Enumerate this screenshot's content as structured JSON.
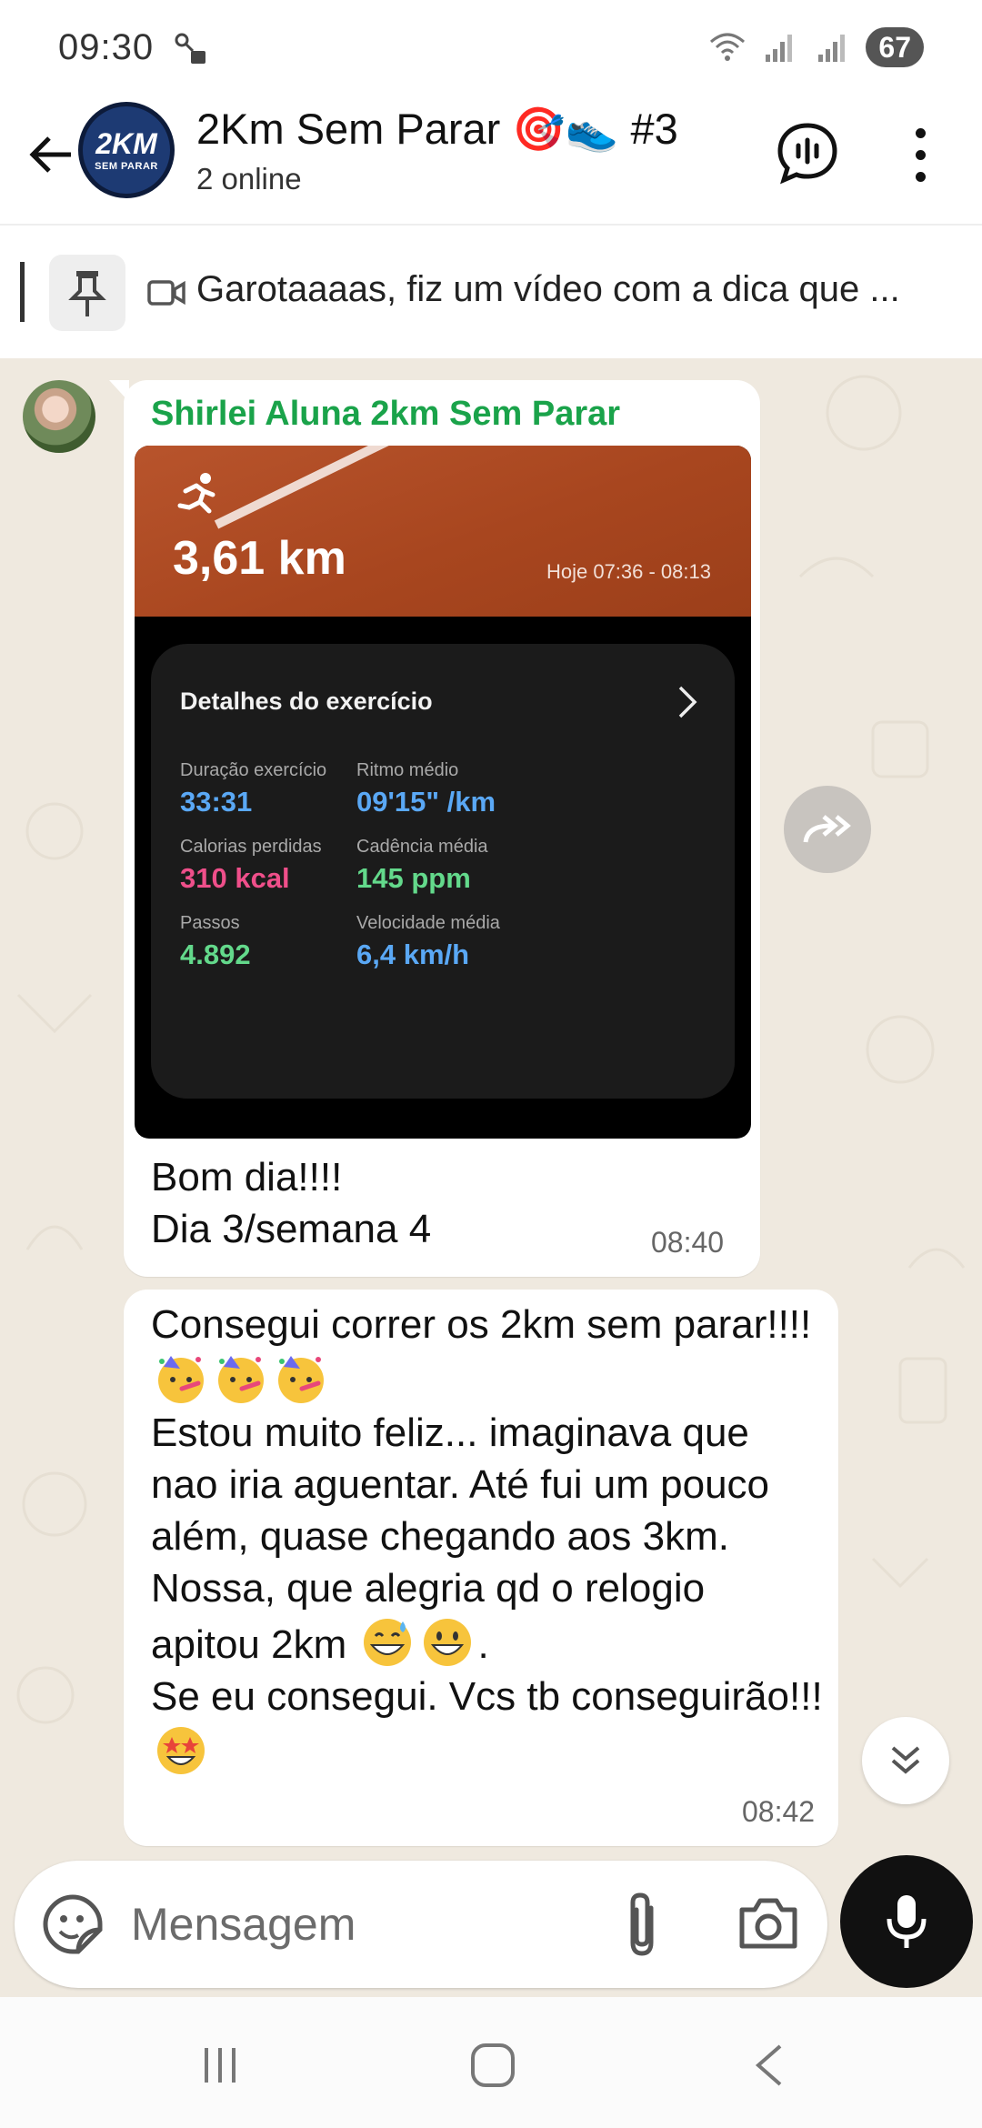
{
  "status_bar": {
    "time": "09:30",
    "battery": "67"
  },
  "header": {
    "title": "2Km Sem Parar 🎯👟 #3",
    "subtitle": "2 online",
    "avatar_big": "2KM",
    "avatar_small": "SEM PARAR"
  },
  "pinned": {
    "text": "Garotaaaas, fiz um vídeo com a dica que ..."
  },
  "messages": [
    {
      "sender": "Shirlei Aluna 2km Sem Parar",
      "media": {
        "distance": "3,61 km",
        "time_range": "Hoje 07:36 - 08:13",
        "card_title": "Detalhes do exercício",
        "metrics": [
          {
            "label": "Duração exercício",
            "value": "33:31",
            "color": "#5aa8f5"
          },
          {
            "label": "Ritmo médio",
            "value": "09'15\" /km",
            "color": "#5aa8f5"
          },
          {
            "label": "Calorias perdidas",
            "value": "310 kcal",
            "color": "#ef4f8a"
          },
          {
            "label": "Cadência média",
            "value": "145 ppm",
            "color": "#63d98b"
          },
          {
            "label": "Passos",
            "value": "4.892",
            "color": "#63d98b"
          },
          {
            "label": "Velocidade média",
            "value": "6,4 km/h",
            "color": "#5aa8f5"
          }
        ]
      },
      "text": "Bom dia!!!!\nDia 3/semana 4",
      "time": "08:40"
    },
    {
      "text_parts": [
        "Consegui correr os 2km sem parar!!!! ",
        "Estou muito feliz... imaginava que nao iria aguentar. Até fui um pouco além,  quase chegando aos 3km. Nossa, que alegria qd o relogio apitou 2km ",
        ".",
        "Se eu consegui. Vcs tb conseguirão!!! "
      ],
      "time": "08:42"
    }
  ],
  "input": {
    "placeholder": "Mensagem"
  },
  "icons": {
    "back": "arrow-left-icon",
    "call": "voice-chat-icon",
    "menu": "more-vert-icon",
    "pin": "pin-icon",
    "video": "video-icon",
    "forward": "forward-icon",
    "scroll_down": "double-chevron-down-icon",
    "sticker": "sticker-icon",
    "attach": "paperclip-icon",
    "camera": "camera-icon",
    "mic": "mic-icon"
  },
  "colors": {
    "sender_name": "#1aa34a",
    "chat_bg": "#efe9df",
    "media_top": "#b8542c",
    "card_bg": "#1b1b1b"
  }
}
